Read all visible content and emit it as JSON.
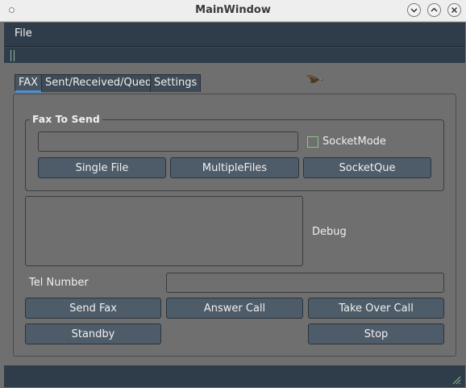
{
  "window": {
    "title": "MainWindow"
  },
  "menu": {
    "file": "File"
  },
  "tabs": [
    {
      "label": "FAX",
      "active": true
    },
    {
      "label": "Sent/Received/Qued",
      "active": false
    },
    {
      "label": "Settings",
      "active": false
    }
  ],
  "fax_to_send": {
    "title": "Fax To Send",
    "file_path": "",
    "socket_mode_label": "SocketMode",
    "socket_mode_checked": false,
    "single_file": "Single File",
    "multiple_files": "MultipleFiles",
    "socket_que": "SocketQue"
  },
  "debug": {
    "text": "",
    "label": "Debug"
  },
  "tel": {
    "label": "Tel Number",
    "value": ""
  },
  "actions": {
    "send_fax": "Send Fax",
    "answer_call": "Answer Call",
    "take_over_call": "Take Over Call",
    "standby": "Standby",
    "stop": "Stop"
  },
  "colors": {
    "background": "#6f6f6f",
    "dark_bar": "#2f3d4a",
    "button": "#4e5c69",
    "tab_accent": "#4b8fd0",
    "checkbox_border": "#8fc08f"
  },
  "icons": {
    "window": "window-menu-icon",
    "minimize": "chevron-down-icon",
    "maximize": "chevron-up-icon",
    "close": "close-icon",
    "logo": "bird-logo-icon",
    "grip": "resize-grip-icon"
  }
}
